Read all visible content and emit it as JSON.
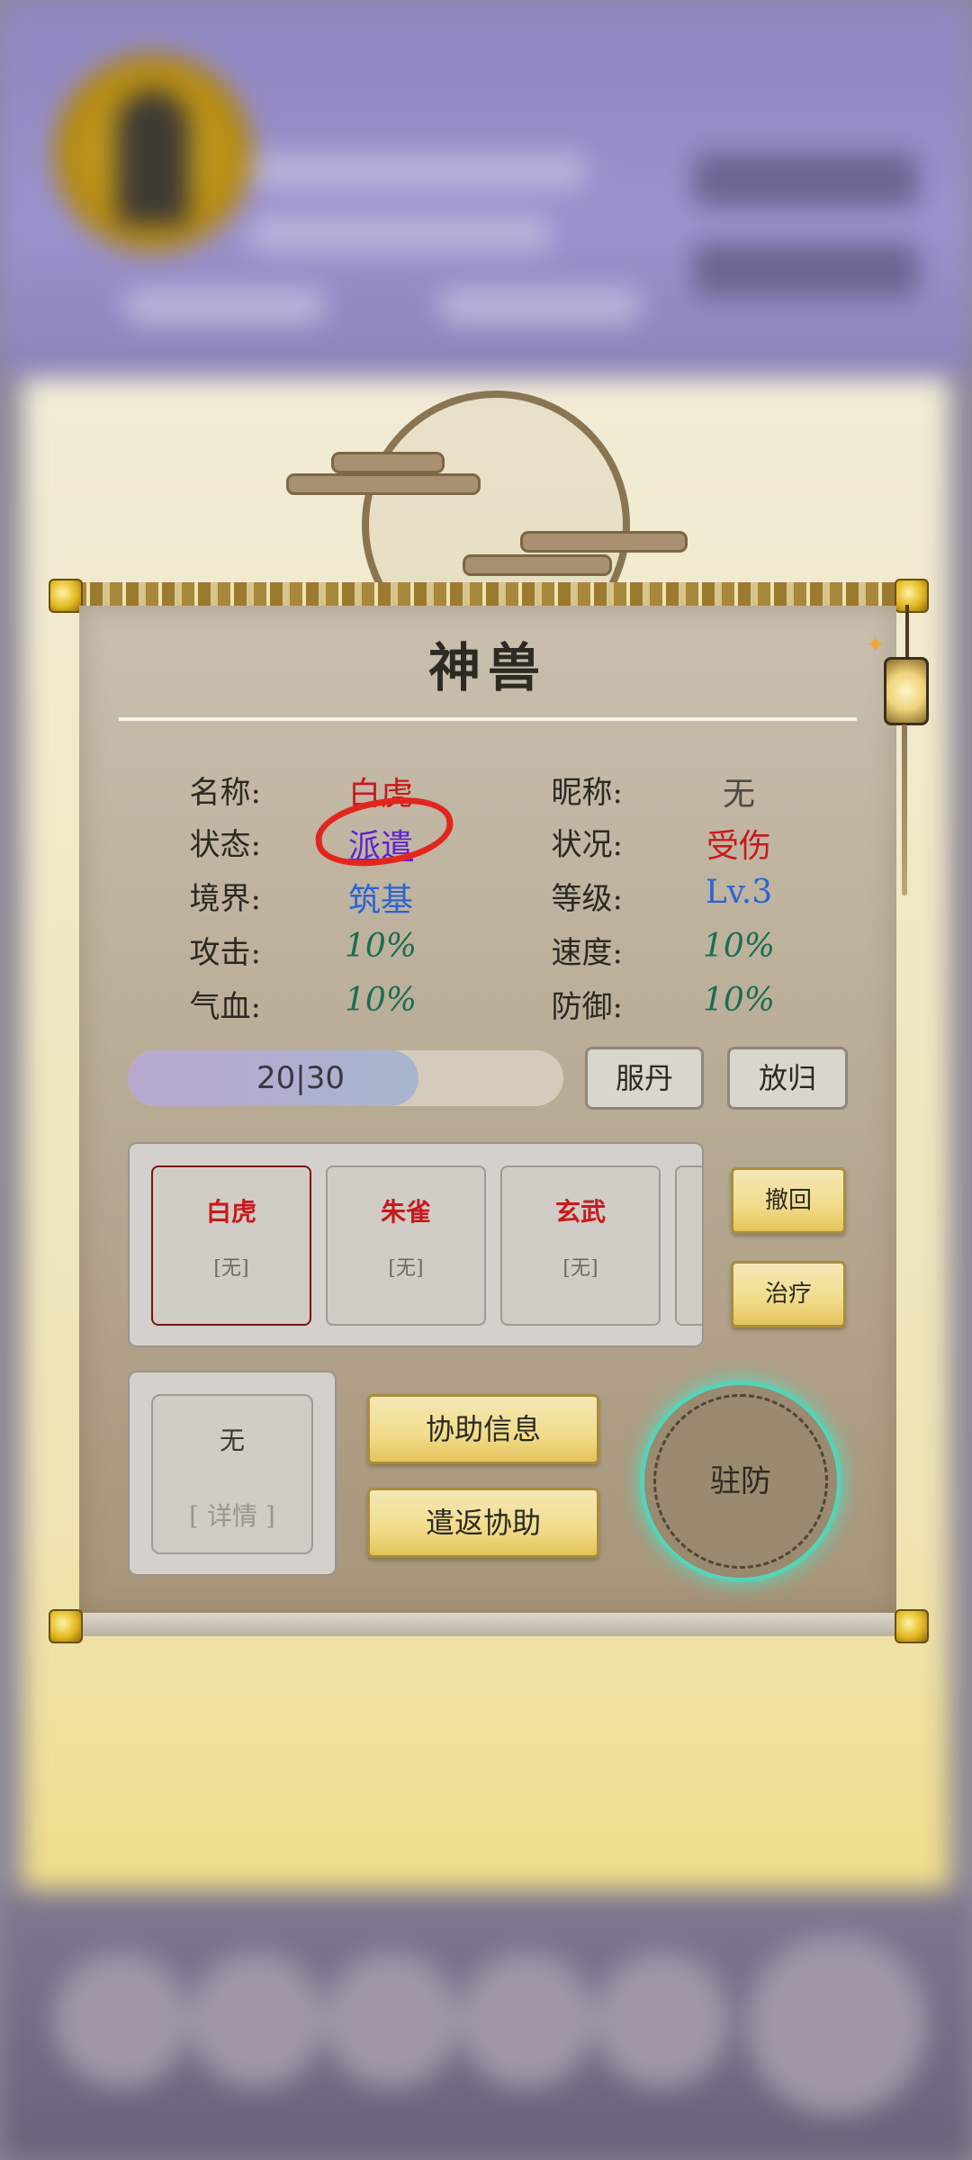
{
  "scroll": {
    "title": "神兽",
    "info": {
      "name_label": "名称:",
      "name_value": "白虎",
      "nick_label": "昵称:",
      "nick_value": "无",
      "status_label": "状态:",
      "status_value": "派遣",
      "condition_label": "状况:",
      "condition_value": "受伤",
      "realm_label": "境界:",
      "realm_value": "筑基",
      "level_label": "等级:",
      "level_value": "Lv.3",
      "attack_label": "攻击:",
      "attack_value": "10%",
      "speed_label": "速度:",
      "speed_value": "10%",
      "hp_label": "气血:",
      "hp_value": "10%",
      "defense_label": "防御:",
      "defense_value": "10%"
    },
    "hp_bar": {
      "text": "20|30",
      "current": 20,
      "max": 30
    },
    "buttons": {
      "take_pill": "服丹",
      "release": "放归",
      "recall": "撤回",
      "heal": "治疗",
      "assist_info": "协助信息",
      "return_assist": "遣返协助",
      "garrison": "驻防"
    },
    "beasts": [
      {
        "name": "白虎",
        "tag": "[无]"
      },
      {
        "name": "朱雀",
        "tag": "[无]"
      },
      {
        "name": "玄武",
        "tag": "[无]"
      }
    ],
    "assist": {
      "name": "无",
      "detail": "[ 详情 ]"
    }
  },
  "colors": {
    "red": "#c8191c",
    "blue": "#2b63d4",
    "green": "#186e52",
    "purple": "#5e24d2",
    "annotation": "#e2261e"
  }
}
